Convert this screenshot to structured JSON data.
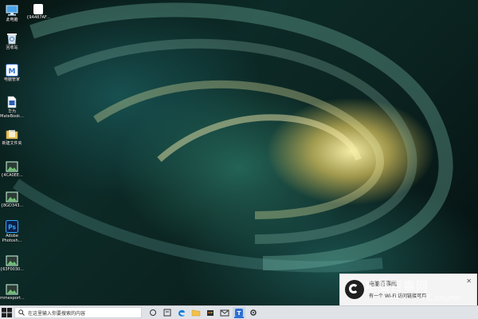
{
  "desktop": {
    "icons": [
      {
        "label": "此电脑",
        "icon": "this-pc-icon",
        "color": "#4aa3e6"
      },
      {
        "label": "回收站",
        "icon": "recycle-bin-icon",
        "color": "#d9e3ea"
      },
      {
        "label": "电脑管家",
        "icon": "pc-manager-icon",
        "color": "#2e6fd1"
      },
      {
        "label": "华为\nMateBook...",
        "icon": "document-icon",
        "color": "#ffffff"
      },
      {
        "label": "新建文件夹",
        "icon": "folder-icon",
        "color": "#e8c25a"
      },
      {
        "label": "{4CA0EE...",
        "icon": "image-file-icon",
        "color": "#6fbf73"
      },
      {
        "label": "{8GD343...",
        "icon": "image-file-icon",
        "color": "#6fbf73"
      },
      {
        "label": "Adobe\nPhotosh...",
        "icon": "photoshop-icon",
        "color": "#0b1f4a"
      },
      {
        "label": "{63F0030...",
        "icon": "image-file-icon",
        "color": "#6fbf73"
      },
      {
        "label": "mmexport...",
        "icon": "image-file-icon",
        "color": "#6fbf73"
      }
    ],
    "top_file": {
      "label": "{9A487AF...",
      "icon": "blank-file-icon",
      "color": "#ffffff"
    }
  },
  "notification": {
    "title": "电脑百事网",
    "message": "有一个 Wi-Fi 访问链接可用",
    "close": "✕"
  },
  "watermark": {
    "main": "电脑百事网",
    "sub": "PConline"
  },
  "taskbar": {
    "search_placeholder": "在这里输入你要搜索的内容",
    "buttons": [
      {
        "name": "task-view-button",
        "icon": "task-view-icon"
      },
      {
        "name": "taskbar-icon-1",
        "icon": "app-icon"
      },
      {
        "name": "edge-button",
        "icon": "edge-icon"
      },
      {
        "name": "file-explorer-button",
        "icon": "folder-icon"
      },
      {
        "name": "store-button",
        "icon": "store-icon"
      },
      {
        "name": "mail-button",
        "icon": "mail-icon"
      },
      {
        "name": "active-app-button",
        "icon": "app-icon"
      },
      {
        "name": "settings-button",
        "icon": "gear-icon"
      }
    ]
  }
}
